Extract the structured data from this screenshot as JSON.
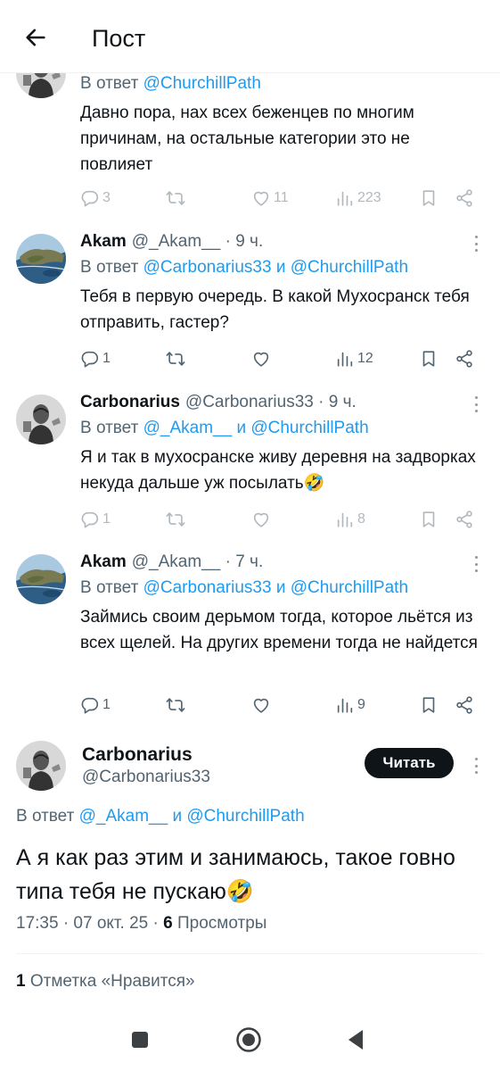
{
  "header": {
    "title": "Пост"
  },
  "tweets": [
    {
      "reply_prefix": "В ответ",
      "reply_to": "@ChurchillPath",
      "text": "Давно пора, нах всех беженцев по многим причинам, на остальные категории это не повлияет",
      "replies": "3",
      "likes": "11",
      "views": "223"
    },
    {
      "name": "Akam",
      "handle": "@_Akam__",
      "time": "· 9 ч.",
      "reply_prefix": "В ответ",
      "reply_to_1": "@Carbonarius33",
      "reply_and": "и",
      "reply_to_2": "@ChurchillPath",
      "text": "Тебя в первую очередь. В какой Мухосранск тебя отправить, гастер?",
      "replies": "1",
      "views": "12"
    },
    {
      "name": "Carbonarius",
      "handle": "@Carbonarius33",
      "time": "· 9 ч.",
      "reply_prefix": "В ответ",
      "reply_to_1": "@_Akam__",
      "reply_and": "и",
      "reply_to_2": "@ChurchillPath",
      "text": "Я и так в мухосранске живу деревня на задворках некуда дальше уж посылать🤣",
      "replies": "1",
      "views": "8"
    },
    {
      "name": "Akam",
      "handle": "@_Akam__",
      "time": "· 7 ч.",
      "reply_prefix": "В ответ",
      "reply_to_1": "@Carbonarius33",
      "reply_and": "и",
      "reply_to_2": "@ChurchillPath",
      "text": "Займись своим дерьмом тогда, которое льётся из всех щелей. На других времени тогда не найдется",
      "replies": "1",
      "views": "9"
    }
  ],
  "main_tweet": {
    "name": "Carbonarius",
    "handle": "@Carbonarius33",
    "follow_label": "Читать",
    "reply_prefix": "В ответ",
    "reply_to_1": "@_Akam__",
    "reply_and": "и",
    "reply_to_2": "@ChurchillPath",
    "text": "А я как раз этим и занимаюсь, такое говно типа тебя не пускаю🤣",
    "timestamp": "17:35 · 07 окт. 25 ·",
    "views_count": "6",
    "views_label": "Просмотры",
    "likes_count": "1",
    "likes_label": "Отметка «Нравится»"
  },
  "colors": {
    "link": "#1d9bf0",
    "text": "#0f1419",
    "secondary": "#536471",
    "button_bg": "#0f1419"
  },
  "icons": [
    "back-arrow-icon",
    "reply-icon",
    "retweet-icon",
    "heart-icon",
    "views-icon",
    "bookmark-icon",
    "share-icon",
    "more-icon",
    "nav-recents-icon",
    "nav-home-icon",
    "nav-back-icon"
  ]
}
